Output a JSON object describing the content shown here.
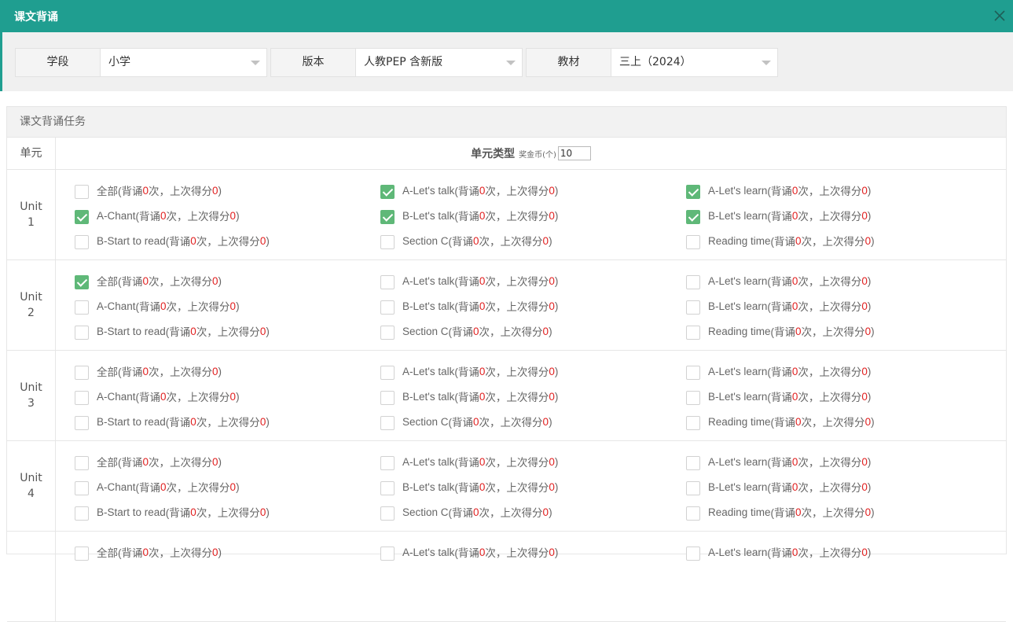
{
  "window": {
    "title": "课文背诵"
  },
  "filters": [
    {
      "label": "学段",
      "value": "小学"
    },
    {
      "label": "版本",
      "value": "人教PEP 含新版"
    },
    {
      "label": "教材",
      "value": "三上（2024）"
    }
  ],
  "panel": {
    "title": "课文背诵任务",
    "unit_header": "单元",
    "type_header": "单元类型",
    "coin_label": "奖金币(个)",
    "coin_value": "10"
  },
  "units": [
    {
      "name_line1": "Unit",
      "name_line2": "1",
      "items": [
        {
          "name": "全部",
          "count": "0",
          "score": "0",
          "checked": false
        },
        {
          "name": "A-Let's talk",
          "count": "0",
          "score": "0",
          "checked": true
        },
        {
          "name": "A-Let's learn",
          "count": "0",
          "score": "0",
          "checked": true
        },
        {
          "name": "A-Chant",
          "count": "0",
          "score": "0",
          "checked": true
        },
        {
          "name": "B-Let's talk",
          "count": "0",
          "score": "0",
          "checked": true
        },
        {
          "name": "B-Let's learn",
          "count": "0",
          "score": "0",
          "checked": true
        },
        {
          "name": "B-Start to read",
          "count": "0",
          "score": "0",
          "checked": false
        },
        {
          "name": "Section C",
          "count": "0",
          "score": "0",
          "checked": false
        },
        {
          "name": "Reading time",
          "count": "0",
          "score": "0",
          "checked": false
        }
      ]
    },
    {
      "name_line1": "Unit",
      "name_line2": "2",
      "items": [
        {
          "name": "全部",
          "count": "0",
          "score": "0",
          "checked": true
        },
        {
          "name": "A-Let's talk",
          "count": "0",
          "score": "0",
          "checked": false
        },
        {
          "name": "A-Let's learn",
          "count": "0",
          "score": "0",
          "checked": false
        },
        {
          "name": "A-Chant",
          "count": "0",
          "score": "0",
          "checked": false
        },
        {
          "name": "B-Let's talk",
          "count": "0",
          "score": "0",
          "checked": false
        },
        {
          "name": "B-Let's learn",
          "count": "0",
          "score": "0",
          "checked": false
        },
        {
          "name": "B-Start to read",
          "count": "0",
          "score": "0",
          "checked": false
        },
        {
          "name": "Section C",
          "count": "0",
          "score": "0",
          "checked": false
        },
        {
          "name": "Reading time",
          "count": "0",
          "score": "0",
          "checked": false
        }
      ]
    },
    {
      "name_line1": "Unit",
      "name_line2": "3",
      "items": [
        {
          "name": "全部",
          "count": "0",
          "score": "0",
          "checked": false
        },
        {
          "name": "A-Let's talk",
          "count": "0",
          "score": "0",
          "checked": false
        },
        {
          "name": "A-Let's learn",
          "count": "0",
          "score": "0",
          "checked": false
        },
        {
          "name": "A-Chant",
          "count": "0",
          "score": "0",
          "checked": false
        },
        {
          "name": "B-Let's talk",
          "count": "0",
          "score": "0",
          "checked": false
        },
        {
          "name": "B-Let's learn",
          "count": "0",
          "score": "0",
          "checked": false
        },
        {
          "name": "B-Start to read",
          "count": "0",
          "score": "0",
          "checked": false
        },
        {
          "name": "Section C",
          "count": "0",
          "score": "0",
          "checked": false
        },
        {
          "name": "Reading time",
          "count": "0",
          "score": "0",
          "checked": false
        }
      ]
    },
    {
      "name_line1": "Unit",
      "name_line2": "4",
      "items": [
        {
          "name": "全部",
          "count": "0",
          "score": "0",
          "checked": false
        },
        {
          "name": "A-Let's talk",
          "count": "0",
          "score": "0",
          "checked": false
        },
        {
          "name": "A-Let's learn",
          "count": "0",
          "score": "0",
          "checked": false
        },
        {
          "name": "A-Chant",
          "count": "0",
          "score": "0",
          "checked": false
        },
        {
          "name": "B-Let's talk",
          "count": "0",
          "score": "0",
          "checked": false
        },
        {
          "name": "B-Let's learn",
          "count": "0",
          "score": "0",
          "checked": false
        },
        {
          "name": "B-Start to read",
          "count": "0",
          "score": "0",
          "checked": false
        },
        {
          "name": "Section C",
          "count": "0",
          "score": "0",
          "checked": false
        },
        {
          "name": "Reading time",
          "count": "0",
          "score": "0",
          "checked": false
        }
      ]
    },
    {
      "name_line1": "",
      "name_line2": "",
      "items": [
        {
          "name": "全部",
          "count": "0",
          "score": "0",
          "checked": false
        },
        {
          "name": "A-Let's talk",
          "count": "0",
          "score": "0",
          "checked": false
        },
        {
          "name": "A-Let's learn",
          "count": "0",
          "score": "0",
          "checked": false
        }
      ]
    }
  ],
  "item_text": {
    "open": "(背诵",
    "times": "次，上次得分",
    "close": ")"
  },
  "colors": {
    "accent": "#1f9e90",
    "checked": "#5fb878",
    "highlight": "#e02020"
  },
  "icons": {
    "close": "close-icon",
    "dropdown": "caret-down-icon"
  }
}
